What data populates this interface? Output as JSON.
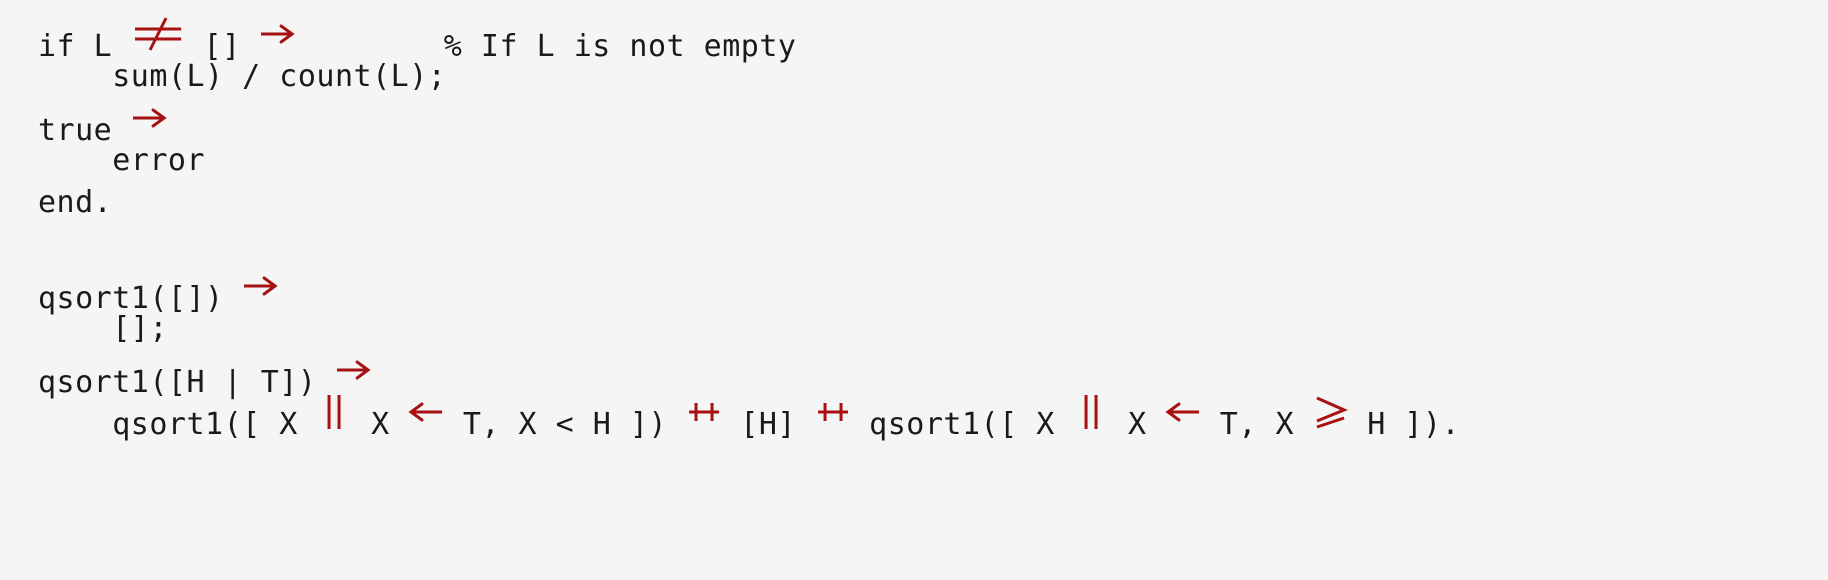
{
  "page": {
    "kind": "code-snippet",
    "language": "Erlang",
    "background_color": "#f5f5f5",
    "text_color": "#1a1a1a",
    "operator_color": "#a81111"
  },
  "code": {
    "lines": [
      {
        "id": "line-1",
        "indent": 0,
        "text": "if L =/= [] ->        % If L is not empty",
        "tokens": [
          {
            "t": "if L ",
            "k": "plain"
          },
          {
            "t": "=/=",
            "k": "lig",
            "glyph": "not-equal-ligature"
          },
          {
            "t": " [] ",
            "k": "plain"
          },
          {
            "t": "->",
            "k": "lig",
            "glyph": "right-arrow-ligature"
          },
          {
            "t": "        % If L is not empty",
            "k": "plain"
          }
        ]
      },
      {
        "id": "line-2",
        "indent": 4,
        "text": "    sum(L) / count(L);",
        "tokens": [
          {
            "t": "    sum(L) / count(L);",
            "k": "plain"
          }
        ]
      },
      {
        "id": "line-3",
        "indent": 0,
        "text": "true ->",
        "tokens": [
          {
            "t": "true ",
            "k": "plain"
          },
          {
            "t": "->",
            "k": "lig",
            "glyph": "right-arrow-ligature"
          }
        ]
      },
      {
        "id": "line-4",
        "indent": 4,
        "text": "    error",
        "tokens": [
          {
            "t": "    error",
            "k": "plain"
          }
        ]
      },
      {
        "id": "line-5",
        "indent": 0,
        "text": "end.",
        "tokens": [
          {
            "t": "end.",
            "k": "plain"
          }
        ]
      },
      {
        "id": "line-6",
        "indent": 0,
        "text": "",
        "tokens": []
      },
      {
        "id": "line-7",
        "indent": 0,
        "text": "qsort1([]) ->",
        "tokens": [
          {
            "t": "qsort1([]) ",
            "k": "plain"
          },
          {
            "t": "->",
            "k": "lig",
            "glyph": "right-arrow-ligature"
          }
        ]
      },
      {
        "id": "line-8",
        "indent": 4,
        "text": "    [];",
        "tokens": [
          {
            "t": "    [];",
            "k": "plain"
          }
        ]
      },
      {
        "id": "line-9",
        "indent": 0,
        "text": "qsort1([H | T]) ->",
        "tokens": [
          {
            "t": "qsort1([H | T]) ",
            "k": "plain"
          },
          {
            "t": "->",
            "k": "lig",
            "glyph": "right-arrow-ligature"
          }
        ]
      },
      {
        "id": "line-10",
        "indent": 4,
        "text": "    qsort1([ X || X <- T, X < H ]) ++ [H] ++ qsort1([ X || X <- T, X >= H ]).",
        "tokens": [
          {
            "t": "    qsort1([ X ",
            "k": "plain"
          },
          {
            "t": "||",
            "k": "lig",
            "glyph": "double-pipe-ligature"
          },
          {
            "t": " X ",
            "k": "plain"
          },
          {
            "t": "<-",
            "k": "lig",
            "glyph": "left-arrow-ligature"
          },
          {
            "t": " T, X < H ]) ",
            "k": "plain"
          },
          {
            "t": "++",
            "k": "lig",
            "glyph": "double-plus-ligature"
          },
          {
            "t": " [H] ",
            "k": "plain"
          },
          {
            "t": "++",
            "k": "lig",
            "glyph": "double-plus-ligature"
          },
          {
            "t": " qsort1([ X ",
            "k": "plain"
          },
          {
            "t": "||",
            "k": "lig",
            "glyph": "double-pipe-ligature"
          },
          {
            "t": " X ",
            "k": "plain"
          },
          {
            "t": "<-",
            "k": "lig",
            "glyph": "left-arrow-ligature"
          },
          {
            "t": " T, X ",
            "k": "plain"
          },
          {
            "t": ">=",
            "k": "lig",
            "glyph": "greater-equal-ligature"
          },
          {
            "t": " H ]).",
            "k": "plain"
          }
        ]
      }
    ]
  }
}
